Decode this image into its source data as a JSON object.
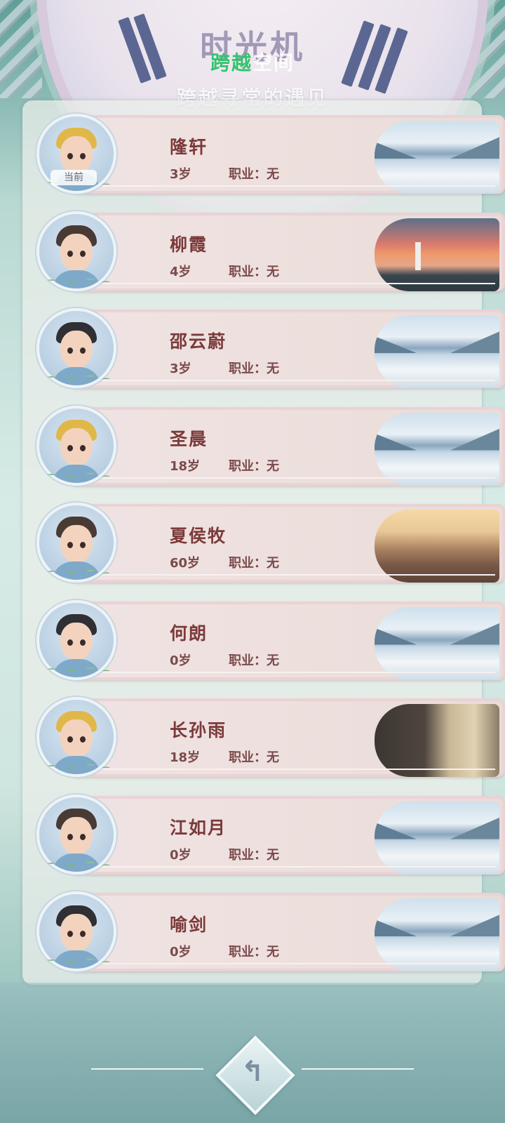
{
  "header": {
    "title": "时光机",
    "subtitle_green": "跨越",
    "subtitle_rest": "空间",
    "tagline": "跨越寻常的遇见"
  },
  "current_tag": "当前",
  "job_prefix": "职业：",
  "characters": [
    {
      "name": "隆轩",
      "age": "3岁",
      "job": "无",
      "scene": "lake",
      "current": true
    },
    {
      "name": "柳霞",
      "age": "4岁",
      "job": "无",
      "scene": "sunset-lighthouse",
      "current": false
    },
    {
      "name": "邵云蔚",
      "age": "3岁",
      "job": "无",
      "scene": "lake",
      "current": false
    },
    {
      "name": "圣晨",
      "age": "18岁",
      "job": "无",
      "scene": "lake",
      "current": false
    },
    {
      "name": "夏侯牧",
      "age": "60岁",
      "job": "无",
      "scene": "misty-mountain",
      "current": false
    },
    {
      "name": "何朗",
      "age": "0岁",
      "job": "无",
      "scene": "lake",
      "current": false
    },
    {
      "name": "长孙雨",
      "age": "18岁",
      "job": "无",
      "scene": "old-town",
      "current": false
    },
    {
      "name": "江如月",
      "age": "0岁",
      "job": "无",
      "scene": "lake",
      "current": false
    },
    {
      "name": "喻剑",
      "age": "0岁",
      "job": "无",
      "scene": "lake",
      "current": false
    }
  ],
  "back_button": {
    "icon": "return-arrow-icon",
    "glyph": "↰"
  }
}
